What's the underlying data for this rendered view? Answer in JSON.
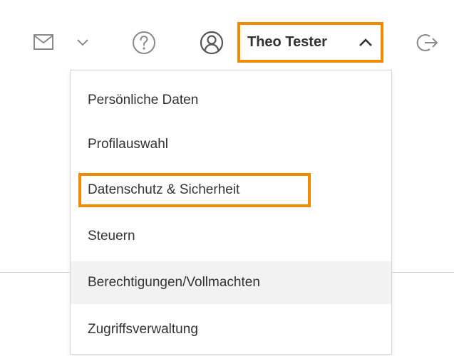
{
  "header": {
    "user_name": "Theo Tester",
    "icons": {
      "mail": "envelope-icon",
      "mail_dropdown": "chevron-down-icon",
      "help": "question-circle-icon",
      "user": "user-circle-icon",
      "user_menu": "chevron-up-icon",
      "logout": "logout-icon"
    }
  },
  "menu": {
    "items": [
      {
        "label": "Persönliche Daten"
      },
      {
        "label": "Profilauswahl"
      },
      {
        "label": "Datenschutz & Sicherheit",
        "highlighted": true
      },
      {
        "label": "Steuern"
      },
      {
        "label": "Berechtigungen/Vollmachten",
        "hovered": true
      },
      {
        "label": "Zugriffsverwaltung"
      }
    ]
  },
  "colors": {
    "highlight": "#f28a00",
    "icon": "#8a8a8a",
    "text": "#333333",
    "hover_bg": "#f2f2f2"
  }
}
